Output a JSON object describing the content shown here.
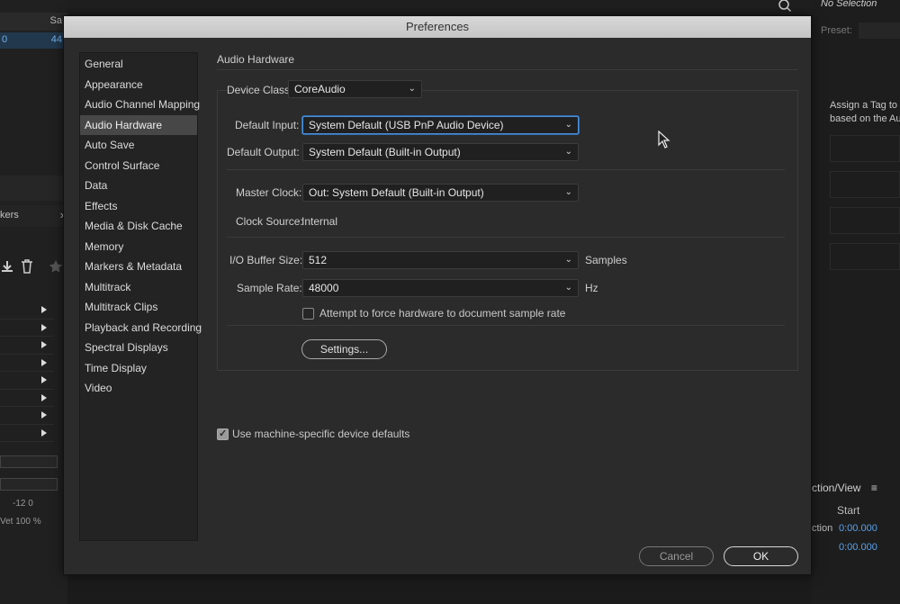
{
  "dialog": {
    "title": "Preferences",
    "nav_items": [
      {
        "label": "General"
      },
      {
        "label": "Appearance"
      },
      {
        "label": "Audio Channel Mapping"
      },
      {
        "label": "Audio Hardware",
        "active": true
      },
      {
        "label": "Auto Save"
      },
      {
        "label": "Control Surface"
      },
      {
        "label": "Data"
      },
      {
        "label": "Effects"
      },
      {
        "label": "Media & Disk Cache"
      },
      {
        "label": "Memory"
      },
      {
        "label": "Markers & Metadata"
      },
      {
        "label": "Multitrack"
      },
      {
        "label": "Multitrack Clips"
      },
      {
        "label": "Playback and Recording"
      },
      {
        "label": "Spectral Displays"
      },
      {
        "label": "Time Display"
      },
      {
        "label": "Video"
      }
    ],
    "section_title": "Audio Hardware",
    "device_class": {
      "label": "Device Class:",
      "value": "CoreAudio"
    },
    "default_input": {
      "label": "Default Input:",
      "value": "System Default (USB PnP Audio Device)"
    },
    "default_output": {
      "label": "Default Output:",
      "value": "System Default (Built-in Output)"
    },
    "master_clock": {
      "label": "Master Clock:",
      "value": "Out: System Default (Built-in Output)"
    },
    "clock_source": {
      "label": "Clock Source:",
      "value": "Internal"
    },
    "buffer_size": {
      "label": "I/O Buffer Size:",
      "value": "512",
      "unit": "Samples"
    },
    "sample_rate": {
      "label": "Sample Rate:",
      "value": "48000",
      "unit": "Hz"
    },
    "force_rate": {
      "label": "Attempt to force hardware to document sample rate",
      "checked": false
    },
    "settings_button": "Settings...",
    "machine_defaults": {
      "label": "Use machine-specific device defaults",
      "checked": true
    },
    "cancel_button": "Cancel",
    "ok_button": "OK"
  },
  "background": {
    "left_header": "Sa",
    "left_selected": "0",
    "left_selected_right": "44",
    "left_tab": "kers",
    "ticks": "-12     0",
    "wet": "Vet    100 %",
    "no_selection": "No Selection",
    "preset": "Preset:",
    "tag_line1": "Assign a Tag to",
    "tag_line2": "based on the Au",
    "selection_view": "ction/View",
    "start": "Start",
    "ction": "ction",
    "time1": "0:00.000",
    "time2": "0:00.000"
  },
  "colors": {
    "accent_focus": "#4e8fd8",
    "time_blue": "#5aa2ea",
    "dialog_bg": "#2b2b2b"
  }
}
